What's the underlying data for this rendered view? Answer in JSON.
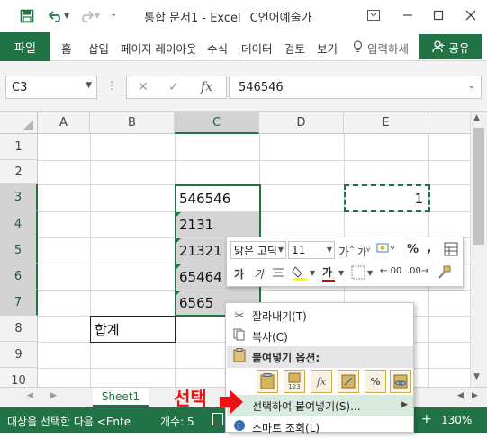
{
  "app": {
    "title": "통합 문서1 - Excel",
    "user": "C언어예술가",
    "accent_color": "#217346"
  },
  "quick_access": {
    "save_icon": "save-icon",
    "undo_icon": "undo-icon",
    "redo_icon": "redo-icon",
    "customize_icon": "customize-icon"
  },
  "window_controls": {
    "restore_icon": "ribbon-display-icon",
    "minimize_icon": "minimize-icon",
    "maximize_icon": "maximize-icon",
    "close_icon": "close-icon"
  },
  "ribbon": {
    "file": "파일",
    "tabs": [
      "홈",
      "삽입",
      "페이지 레이아웃",
      "수식",
      "데이터",
      "검토",
      "보기"
    ],
    "tell_me": "입력하세",
    "share": "공유"
  },
  "formula_bar": {
    "name_box": "C3",
    "fx": "fx",
    "value": "546546"
  },
  "grid": {
    "columns": [
      "A",
      "B",
      "C",
      "D",
      "E"
    ],
    "rows": [
      "1",
      "2",
      "3",
      "4",
      "5",
      "6",
      "7",
      "8",
      "9",
      "10"
    ],
    "cells": {
      "C3": "546546",
      "C4": "2131",
      "C5": "21321",
      "C6": "65464",
      "C7": "6565",
      "B8": "합계",
      "E3": "1"
    }
  },
  "mini_toolbar": {
    "font_name": "맑은 고딕",
    "font_size": "11",
    "increase_font": "가",
    "decrease_font": "가",
    "percent": "%",
    "comma": ",",
    "bold": "가",
    "italic": "가",
    "font_color_glyph": "가",
    "decimal_increase": ".00",
    "decimal_decrease": ".00"
  },
  "context_menu": {
    "cut": "잘라내기(T)",
    "copy": "복사(C)",
    "paste_options": "붙여넣기 옵션:",
    "paste_special": "선택하여 붙여넣기(S)...",
    "smart_lookup": "스마트 조회(L)",
    "paste_option_values_label": "123"
  },
  "sheet_tabs": {
    "active": "Sheet1"
  },
  "status_bar": {
    "message": "대상을 선택한 다음 <Ente",
    "count": "개수: 5",
    "zoom": "130%"
  },
  "annotation": {
    "text": "선택"
  }
}
